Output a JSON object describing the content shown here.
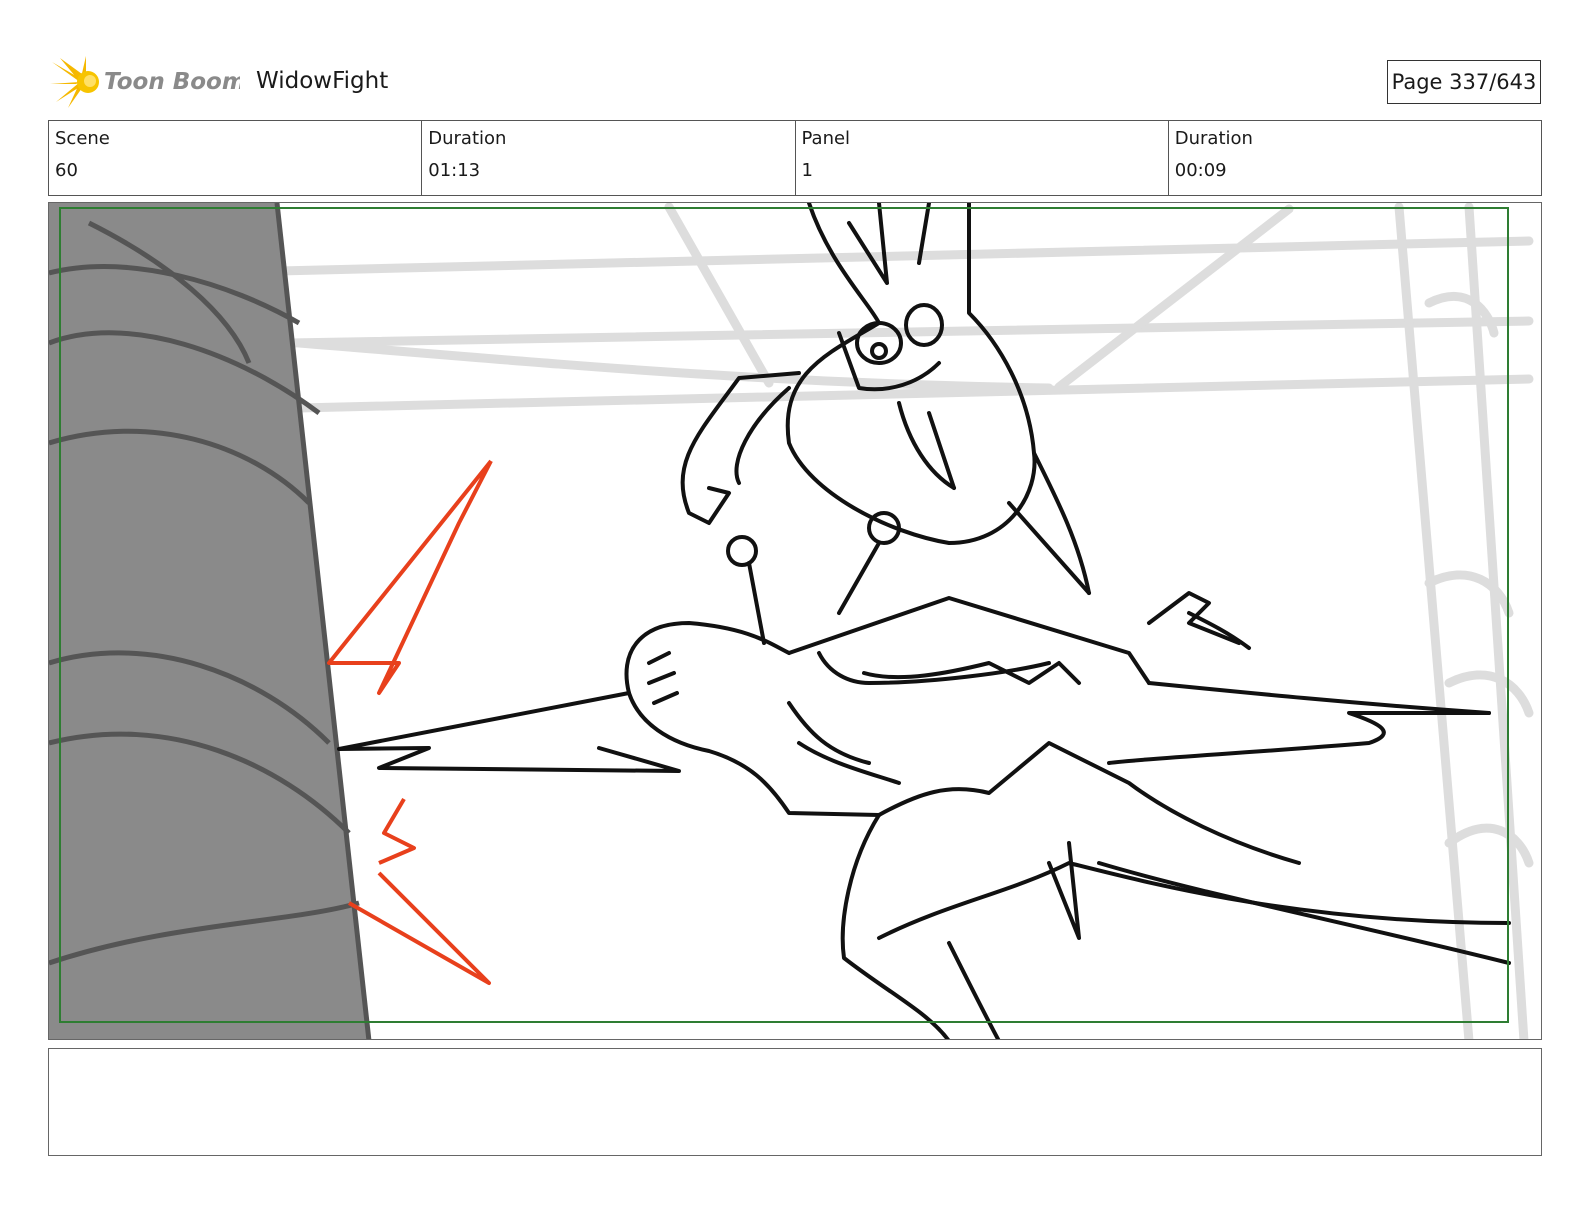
{
  "header": {
    "brand": "Toon Boom",
    "project_title": "WidowFight",
    "page_label": "Page 337/643"
  },
  "info": {
    "scene_label": "Scene",
    "scene_value": "60",
    "scene_duration_label": "Duration",
    "scene_duration_value": "01:13",
    "panel_label": "Panel",
    "panel_value": "1",
    "panel_duration_label": "Duration",
    "panel_duration_value": "00:09"
  },
  "colors": {
    "frame_green": "#2e7d32",
    "accent_red": "#e8401c",
    "tree_gray": "#8a8a8a",
    "logo_yellow": "#f5b800"
  },
  "notes": {
    "text": ""
  }
}
